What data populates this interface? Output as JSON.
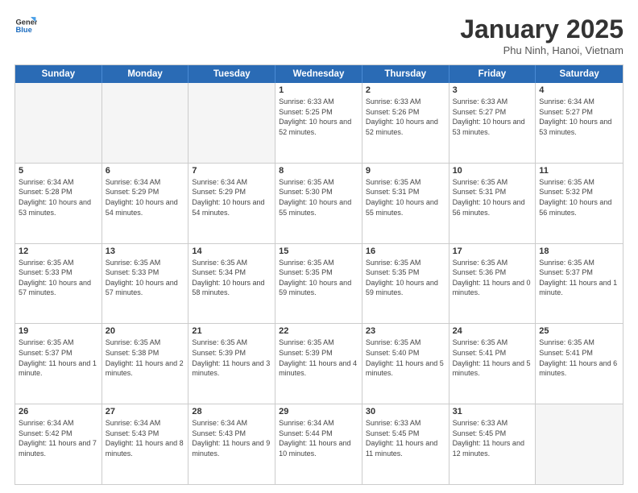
{
  "logo": {
    "general": "General",
    "blue": "Blue"
  },
  "title": "January 2025",
  "subtitle": "Phu Ninh, Hanoi, Vietnam",
  "header_days": [
    "Sunday",
    "Monday",
    "Tuesday",
    "Wednesday",
    "Thursday",
    "Friday",
    "Saturday"
  ],
  "weeks": [
    [
      {
        "day": "",
        "info": ""
      },
      {
        "day": "",
        "info": ""
      },
      {
        "day": "",
        "info": ""
      },
      {
        "day": "1",
        "info": "Sunrise: 6:33 AM\nSunset: 5:25 PM\nDaylight: 10 hours and 52 minutes."
      },
      {
        "day": "2",
        "info": "Sunrise: 6:33 AM\nSunset: 5:26 PM\nDaylight: 10 hours and 52 minutes."
      },
      {
        "day": "3",
        "info": "Sunrise: 6:33 AM\nSunset: 5:27 PM\nDaylight: 10 hours and 53 minutes."
      },
      {
        "day": "4",
        "info": "Sunrise: 6:34 AM\nSunset: 5:27 PM\nDaylight: 10 hours and 53 minutes."
      }
    ],
    [
      {
        "day": "5",
        "info": "Sunrise: 6:34 AM\nSunset: 5:28 PM\nDaylight: 10 hours and 53 minutes."
      },
      {
        "day": "6",
        "info": "Sunrise: 6:34 AM\nSunset: 5:29 PM\nDaylight: 10 hours and 54 minutes."
      },
      {
        "day": "7",
        "info": "Sunrise: 6:34 AM\nSunset: 5:29 PM\nDaylight: 10 hours and 54 minutes."
      },
      {
        "day": "8",
        "info": "Sunrise: 6:35 AM\nSunset: 5:30 PM\nDaylight: 10 hours and 55 minutes."
      },
      {
        "day": "9",
        "info": "Sunrise: 6:35 AM\nSunset: 5:31 PM\nDaylight: 10 hours and 55 minutes."
      },
      {
        "day": "10",
        "info": "Sunrise: 6:35 AM\nSunset: 5:31 PM\nDaylight: 10 hours and 56 minutes."
      },
      {
        "day": "11",
        "info": "Sunrise: 6:35 AM\nSunset: 5:32 PM\nDaylight: 10 hours and 56 minutes."
      }
    ],
    [
      {
        "day": "12",
        "info": "Sunrise: 6:35 AM\nSunset: 5:33 PM\nDaylight: 10 hours and 57 minutes."
      },
      {
        "day": "13",
        "info": "Sunrise: 6:35 AM\nSunset: 5:33 PM\nDaylight: 10 hours and 57 minutes."
      },
      {
        "day": "14",
        "info": "Sunrise: 6:35 AM\nSunset: 5:34 PM\nDaylight: 10 hours and 58 minutes."
      },
      {
        "day": "15",
        "info": "Sunrise: 6:35 AM\nSunset: 5:35 PM\nDaylight: 10 hours and 59 minutes."
      },
      {
        "day": "16",
        "info": "Sunrise: 6:35 AM\nSunset: 5:35 PM\nDaylight: 10 hours and 59 minutes."
      },
      {
        "day": "17",
        "info": "Sunrise: 6:35 AM\nSunset: 5:36 PM\nDaylight: 11 hours and 0 minutes."
      },
      {
        "day": "18",
        "info": "Sunrise: 6:35 AM\nSunset: 5:37 PM\nDaylight: 11 hours and 1 minute."
      }
    ],
    [
      {
        "day": "19",
        "info": "Sunrise: 6:35 AM\nSunset: 5:37 PM\nDaylight: 11 hours and 1 minute."
      },
      {
        "day": "20",
        "info": "Sunrise: 6:35 AM\nSunset: 5:38 PM\nDaylight: 11 hours and 2 minutes."
      },
      {
        "day": "21",
        "info": "Sunrise: 6:35 AM\nSunset: 5:39 PM\nDaylight: 11 hours and 3 minutes."
      },
      {
        "day": "22",
        "info": "Sunrise: 6:35 AM\nSunset: 5:39 PM\nDaylight: 11 hours and 4 minutes."
      },
      {
        "day": "23",
        "info": "Sunrise: 6:35 AM\nSunset: 5:40 PM\nDaylight: 11 hours and 5 minutes."
      },
      {
        "day": "24",
        "info": "Sunrise: 6:35 AM\nSunset: 5:41 PM\nDaylight: 11 hours and 5 minutes."
      },
      {
        "day": "25",
        "info": "Sunrise: 6:35 AM\nSunset: 5:41 PM\nDaylight: 11 hours and 6 minutes."
      }
    ],
    [
      {
        "day": "26",
        "info": "Sunrise: 6:34 AM\nSunset: 5:42 PM\nDaylight: 11 hours and 7 minutes."
      },
      {
        "day": "27",
        "info": "Sunrise: 6:34 AM\nSunset: 5:43 PM\nDaylight: 11 hours and 8 minutes."
      },
      {
        "day": "28",
        "info": "Sunrise: 6:34 AM\nSunset: 5:43 PM\nDaylight: 11 hours and 9 minutes."
      },
      {
        "day": "29",
        "info": "Sunrise: 6:34 AM\nSunset: 5:44 PM\nDaylight: 11 hours and 10 minutes."
      },
      {
        "day": "30",
        "info": "Sunrise: 6:33 AM\nSunset: 5:45 PM\nDaylight: 11 hours and 11 minutes."
      },
      {
        "day": "31",
        "info": "Sunrise: 6:33 AM\nSunset: 5:45 PM\nDaylight: 11 hours and 12 minutes."
      },
      {
        "day": "",
        "info": ""
      }
    ]
  ]
}
